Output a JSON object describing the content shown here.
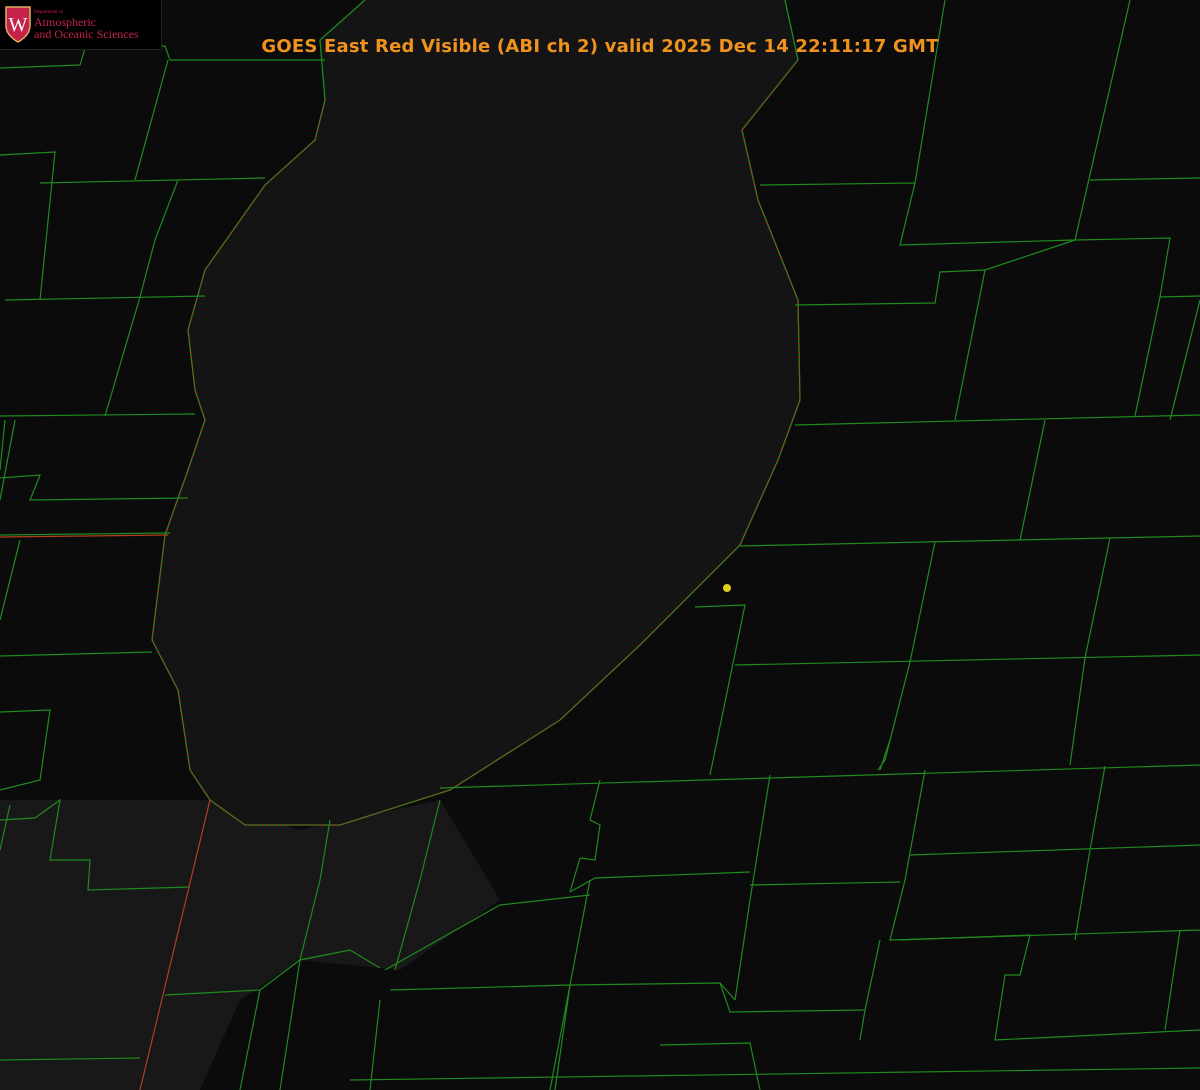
{
  "title": "GOES East Red Visible (ABI ch 2) valid 2025 Dec 14 22:11:17 GMT",
  "logo": {
    "department": "Department of",
    "line1": "Atmospheric",
    "line2": "and Oceanic Sciences",
    "emblem_letter": "W"
  },
  "colors": {
    "background": "#0a0a0a",
    "lake": "#111111",
    "county_lines": "#1f8a1f",
    "state_border": "#c0392b",
    "shoreline_dots": "#e02020",
    "marker": "#e0d020",
    "title": "#f0921e",
    "logo": "#c5224a"
  }
}
